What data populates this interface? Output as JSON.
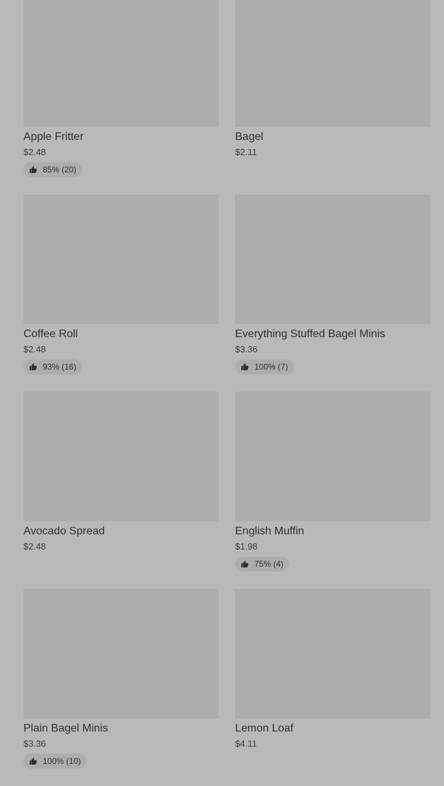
{
  "products": [
    {
      "name": "Apple Fritter",
      "price": "$2.48",
      "rating": "85% (20)",
      "has_rating": true
    },
    {
      "name": "Bagel",
      "price": "$2.11",
      "rating": "",
      "has_rating": false
    },
    {
      "name": "Coffee Roll",
      "price": "$2.48",
      "rating": "93% (16)",
      "has_rating": true
    },
    {
      "name": "Everything Stuffed Bagel Minis",
      "price": "$3.36",
      "rating": "100% (7)",
      "has_rating": true
    },
    {
      "name": "Avocado Spread",
      "price": "$2.48",
      "rating": "",
      "has_rating": false
    },
    {
      "name": "English Muffin",
      "price": "$1.98",
      "rating": "75% (4)",
      "has_rating": true
    },
    {
      "name": "Plain Bagel Minis",
      "price": "$3.36",
      "rating": "100% (10)",
      "has_rating": true
    },
    {
      "name": "Lemon Loaf",
      "price": "$4.11",
      "rating": "",
      "has_rating": false
    }
  ],
  "icons": {
    "rating_icon": "thumbs-up-icon"
  },
  "colors": {
    "background": "#b9b9b9",
    "image_placeholder": "#adadad",
    "rating_pill": "#adadad",
    "text": "#2f2f2f"
  }
}
